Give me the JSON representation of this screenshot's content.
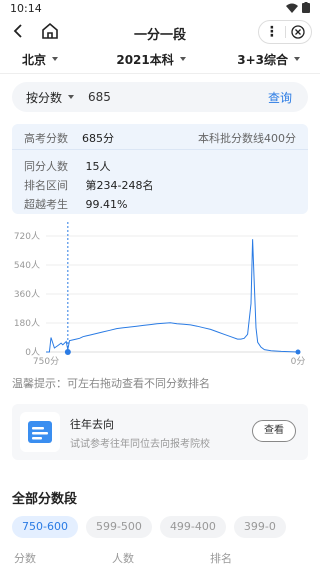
{
  "status_bar": {
    "time": "10:14"
  },
  "nav": {
    "title": "一分一段",
    "more": "⋮"
  },
  "filters": {
    "province": "北京",
    "year_type": "2021本科",
    "subject": "3+3综合"
  },
  "search": {
    "mode": "按分数",
    "value": "685",
    "query_button": "查询"
  },
  "info": {
    "score_label": "高考分数",
    "score_value": "685分",
    "cutoff": "本科批分数线400分",
    "same_label": "同分人数",
    "same_value": "15人",
    "rank_label": "排名区间",
    "rank_value": "第234-248名",
    "beat_label": "超越考生",
    "beat_value": "99.41%"
  },
  "chart_data": {
    "type": "line",
    "y_ticks": [
      "720人",
      "540人",
      "360人",
      "180人",
      "0人"
    ],
    "x_labels": [
      "750分",
      "0分"
    ],
    "ylim": [
      0,
      720
    ],
    "xlim": [
      750,
      0
    ],
    "series_color": "#2a7be4",
    "points": [
      [
        750,
        0
      ],
      [
        740,
        0
      ],
      [
        735,
        90
      ],
      [
        725,
        25
      ],
      [
        715,
        40
      ],
      [
        705,
        55
      ],
      [
        700,
        45
      ],
      [
        690,
        65
      ],
      [
        685,
        15
      ],
      [
        680,
        70
      ],
      [
        670,
        75
      ],
      [
        660,
        80
      ],
      [
        650,
        85
      ],
      [
        640,
        95
      ],
      [
        630,
        100
      ],
      [
        620,
        105
      ],
      [
        600,
        115
      ],
      [
        580,
        125
      ],
      [
        560,
        135
      ],
      [
        540,
        145
      ],
      [
        520,
        150
      ],
      [
        500,
        155
      ],
      [
        480,
        160
      ],
      [
        460,
        165
      ],
      [
        440,
        170
      ],
      [
        420,
        175
      ],
      [
        400,
        178
      ],
      [
        380,
        182
      ],
      [
        360,
        175
      ],
      [
        340,
        172
      ],
      [
        320,
        168
      ],
      [
        300,
        160
      ],
      [
        280,
        150
      ],
      [
        260,
        140
      ],
      [
        240,
        125
      ],
      [
        220,
        110
      ],
      [
        200,
        95
      ],
      [
        180,
        80
      ],
      [
        170,
        80
      ],
      [
        160,
        85
      ],
      [
        150,
        110
      ],
      [
        140,
        300
      ],
      [
        135,
        700
      ],
      [
        130,
        420
      ],
      [
        125,
        150
      ],
      [
        120,
        60
      ],
      [
        110,
        30
      ],
      [
        100,
        15
      ],
      [
        80,
        8
      ],
      [
        50,
        4
      ],
      [
        20,
        2
      ],
      [
        0,
        0
      ]
    ],
    "marker_score": 685
  },
  "tip": "温馨提示：可左右拖动查看不同分数排名",
  "promo": {
    "title": "往年去向",
    "desc": "试试参考往年同位去向报考院校",
    "button": "查看"
  },
  "section_title": "全部分数段",
  "ranges": [
    "750-600",
    "599-500",
    "499-400",
    "399-0"
  ],
  "table_headers": {
    "score": "分数",
    "count": "人数",
    "rank": "排名"
  }
}
